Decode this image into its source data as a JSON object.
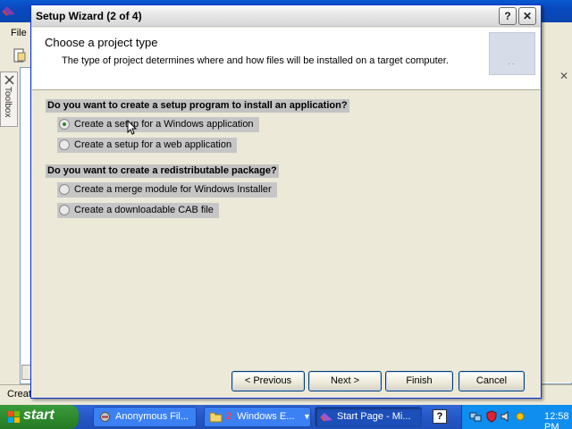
{
  "ide": {
    "menu_file": "File",
    "toolbox_label": "Toolbox",
    "status_text": "Creat"
  },
  "wizard": {
    "title": "Setup Wizard (2 of 4)",
    "help_symbol": "?",
    "close_symbol": "✕",
    "header_title": "Choose a project type",
    "header_desc": "The type of project determines where and how files will be installed on a target computer.",
    "question1": "Do you want to create a setup program to install an application?",
    "question2": "Do you want to create a redistributable package?",
    "options": [
      {
        "label": "Create a setup for a Windows application",
        "checked": true
      },
      {
        "label": "Create a setup for a web application",
        "checked": false
      },
      {
        "label": "Create a merge module for Windows Installer",
        "checked": false
      },
      {
        "label": "Create a downloadable CAB file",
        "checked": false
      }
    ],
    "buttons": {
      "previous": "< Previous",
      "next": "Next >",
      "finish": "Finish",
      "cancel": "Cancel"
    }
  },
  "taskbar": {
    "start_label": "start",
    "tasks": [
      {
        "label": "Anonymous Fil..."
      },
      {
        "count": "2",
        "label": "Windows E..."
      },
      {
        "label": "Start Page - Mi..."
      }
    ],
    "help_symbol": "?",
    "clock": "12:58 PM"
  },
  "colors": {
    "dialog_border": "#0831d9",
    "taskbar": "#2457c8",
    "start_green": "#2e8b2e",
    "tray": "#0f8ef0"
  },
  "icons": [
    "vs-app-icon",
    "toolbox-icon",
    "help-icon",
    "close-icon",
    "windows-logo-icon",
    "folder-icon",
    "network-icon",
    "volume-icon",
    "security-icon",
    "mouse-cursor-icon"
  ]
}
